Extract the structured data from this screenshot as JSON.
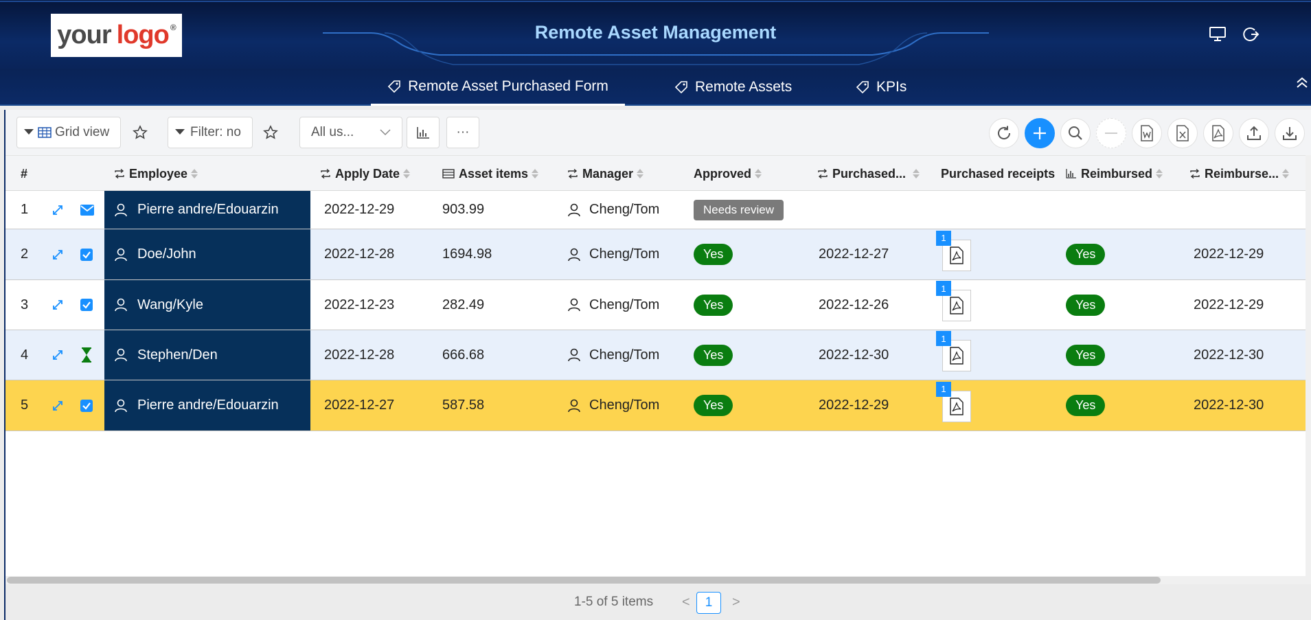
{
  "logo": {
    "word1": "your",
    "word2": "logo",
    "reg": "®"
  },
  "header": {
    "title": "Remote Asset Management",
    "icons": [
      "monitor-icon",
      "refresh-logout-icon"
    ]
  },
  "nav": {
    "tabs": [
      {
        "label": "Remote Asset Purchased Form",
        "icon": "tag-icon",
        "active": true
      },
      {
        "label": "Remote Assets",
        "icon": "tag-icon",
        "active": false
      },
      {
        "label": "KPIs",
        "icon": "tag-icon",
        "active": false
      }
    ],
    "collapse_icon": "double-chevron-up-icon"
  },
  "toolbar": {
    "view_label": "Grid view",
    "filter_label": "Filter: no",
    "users_select": "All us...",
    "more_label": "···",
    "right_icons": [
      "refresh-icon",
      "add-icon",
      "search-icon",
      "remove-icon",
      "word-export-icon",
      "excel-export-icon",
      "pdf-export-icon",
      "upload-icon",
      "download-icon"
    ]
  },
  "table": {
    "columns": {
      "num": "#",
      "employee": "Employee",
      "apply_date": "Apply Date",
      "asset_items": "Asset items",
      "manager": "Manager",
      "approved": "Approved",
      "purchased": "Purchased...",
      "purchased_receipts": "Purchased receipts",
      "reimbursed": "Reimbursed",
      "reimbursed_date": "Reimburse..."
    },
    "rows": [
      {
        "num": "1",
        "status_icon": "envelope-icon",
        "employee": "Pierre andre/Edouarzin",
        "apply_date": "2022-12-29",
        "asset_items": "903.99",
        "manager": "Cheng/Tom",
        "approved": "Needs review",
        "purchased": "",
        "receipts": "",
        "reimbursed": "",
        "reimbursed_date": ""
      },
      {
        "num": "2",
        "status_icon": "checkbox-checked-icon",
        "employee": "Doe/John",
        "apply_date": "2022-12-28",
        "asset_items": "1694.98",
        "manager": "Cheng/Tom",
        "approved": "Yes",
        "purchased": "2022-12-27",
        "receipts": "1",
        "reimbursed": "Yes",
        "reimbursed_date": "2022-12-29"
      },
      {
        "num": "3",
        "status_icon": "checkbox-checked-icon",
        "employee": "Wang/Kyle",
        "apply_date": "2022-12-23",
        "asset_items": "282.49",
        "manager": "Cheng/Tom",
        "approved": "Yes",
        "purchased": "2022-12-26",
        "receipts": "1",
        "reimbursed": "Yes",
        "reimbursed_date": "2022-12-29"
      },
      {
        "num": "4",
        "status_icon": "hourglass-icon",
        "employee": "Stephen/Den",
        "apply_date": "2022-12-28",
        "asset_items": "666.68",
        "manager": "Cheng/Tom",
        "approved": "Yes",
        "purchased": "2022-12-30",
        "receipts": "1",
        "reimbursed": "Yes",
        "reimbursed_date": "2022-12-30"
      },
      {
        "num": "5",
        "status_icon": "checkbox-checked-icon",
        "employee": "Pierre andre/Edouarzin",
        "apply_date": "2022-12-27",
        "asset_items": "587.58",
        "manager": "Cheng/Tom",
        "approved": "Yes",
        "purchased": "2022-12-29",
        "receipts": "1",
        "reimbursed": "Yes",
        "reimbursed_date": "2022-12-30"
      }
    ]
  },
  "pagination": {
    "summary": "1-5 of 5 items",
    "prev": "<",
    "page": "1",
    "next": ">"
  },
  "colors": {
    "header_bg": "#0b2a66",
    "title": "#a9d8ff",
    "primary": "#1890ff",
    "employee_bg": "#06305a",
    "badge_green": "#0a7d10",
    "selected_row": "#fdd44f",
    "even_row": "#e8f0fb"
  }
}
